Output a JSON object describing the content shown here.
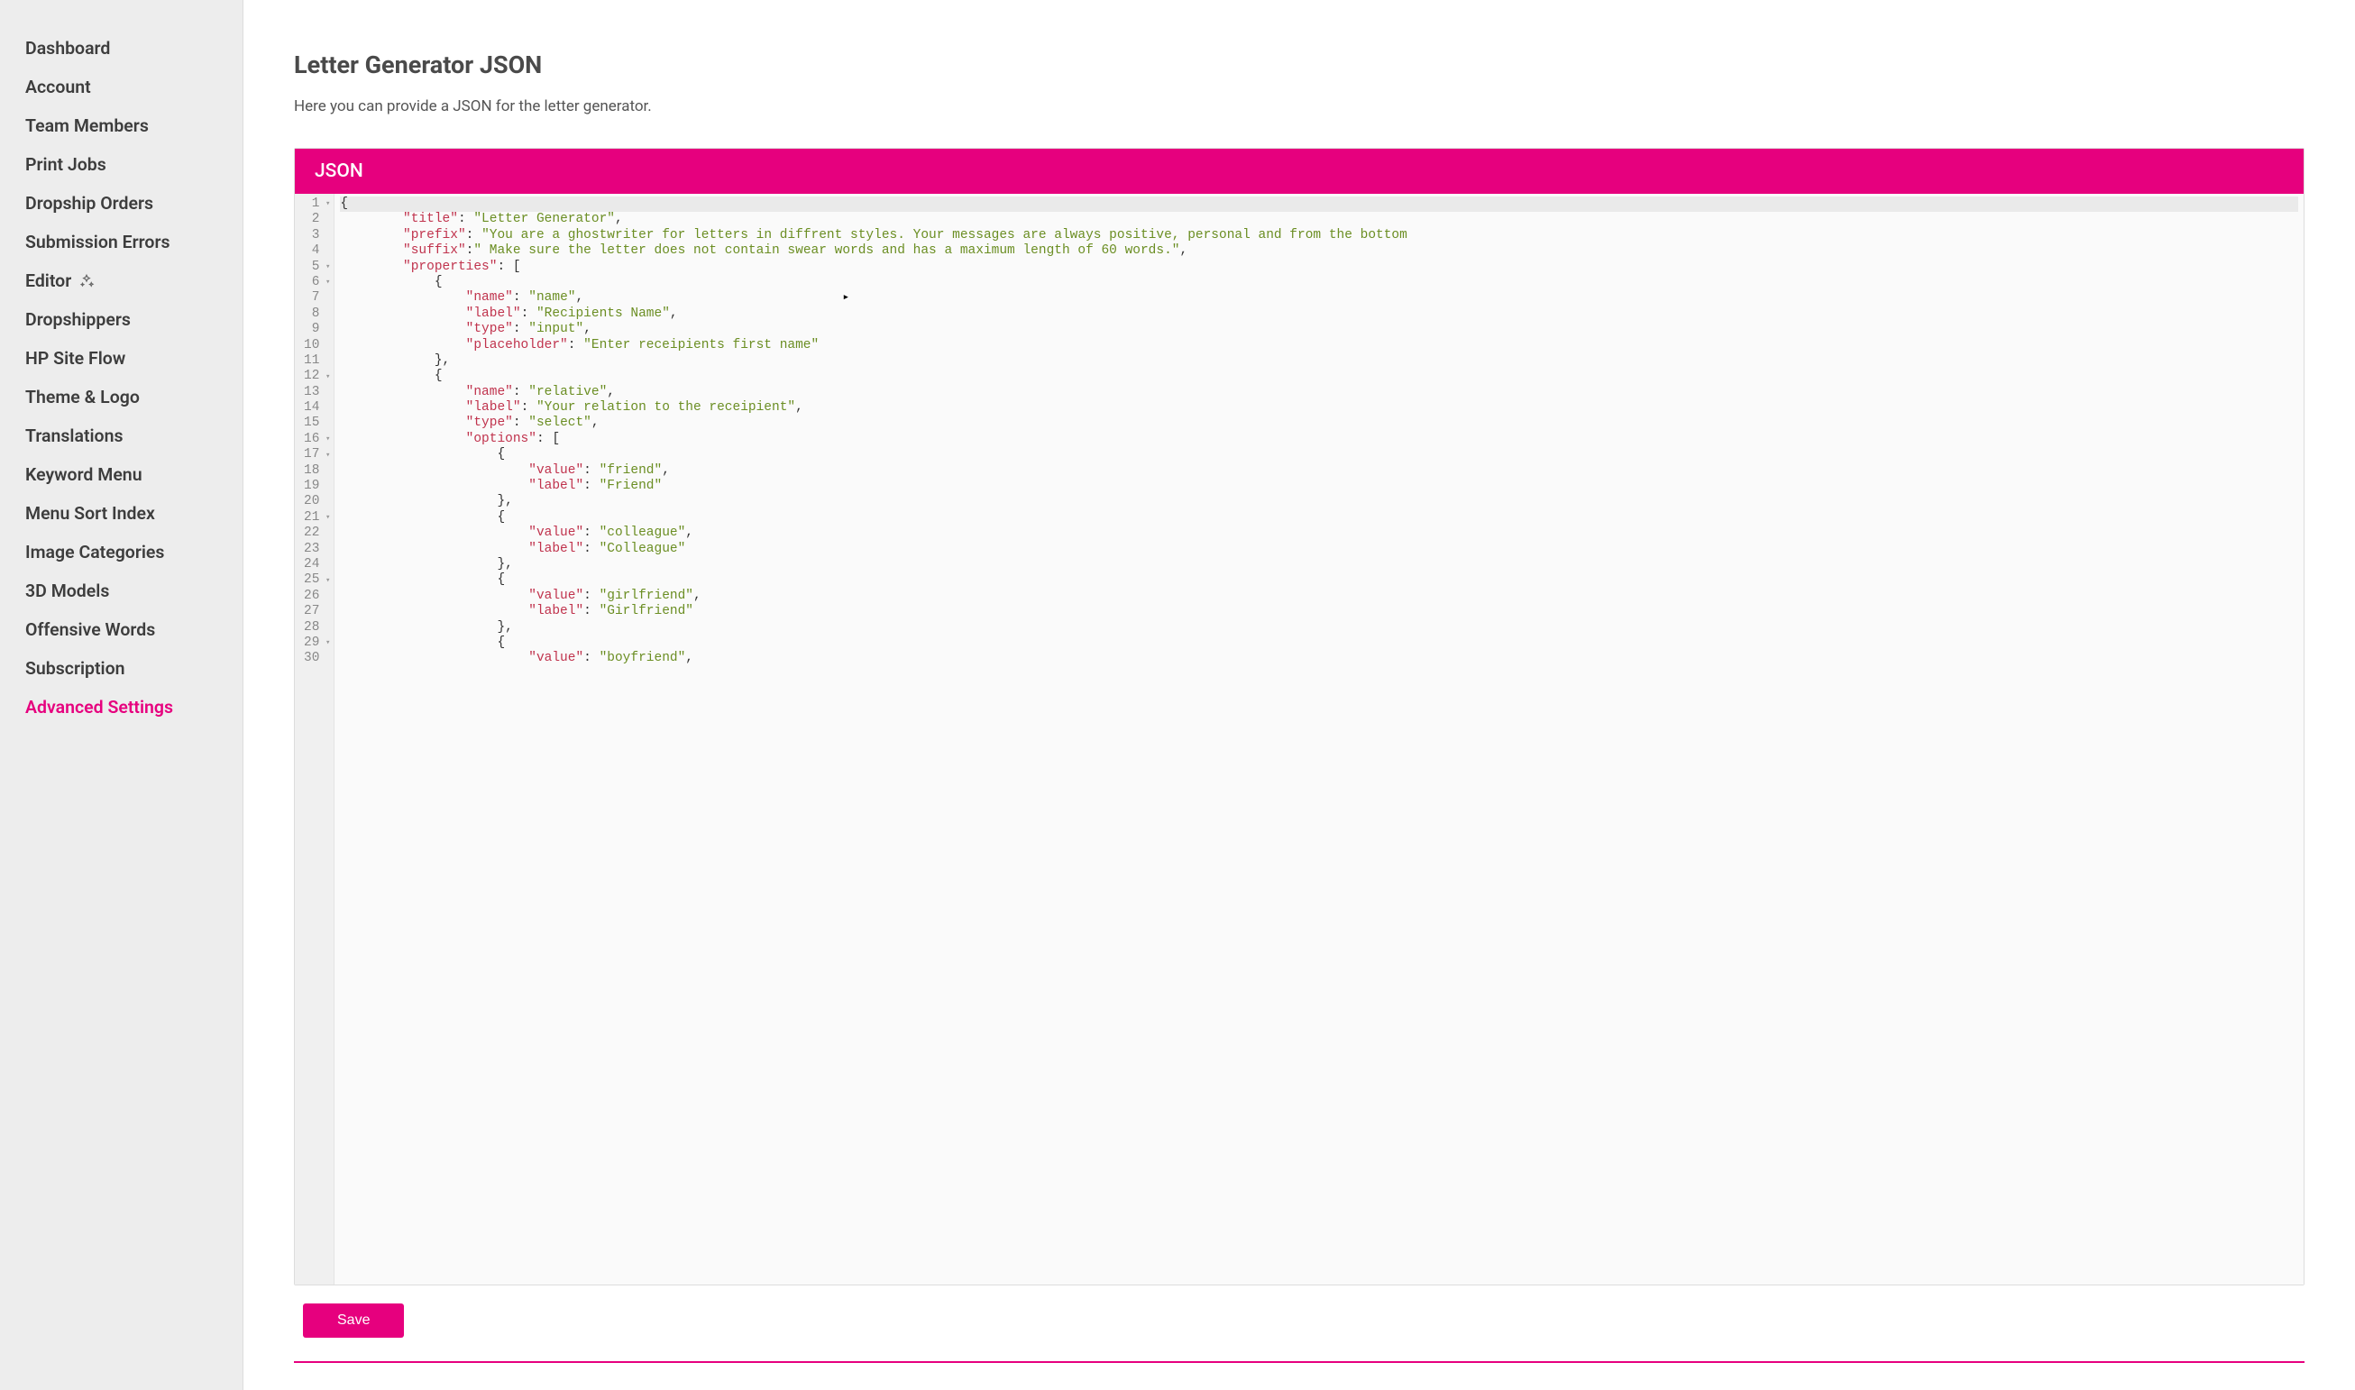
{
  "sidebar": {
    "items": [
      {
        "label": "Dashboard",
        "icon": null,
        "active": false
      },
      {
        "label": "Account",
        "icon": null,
        "active": false
      },
      {
        "label": "Team Members",
        "icon": null,
        "active": false
      },
      {
        "label": "Print Jobs",
        "icon": null,
        "active": false
      },
      {
        "label": "Dropship Orders",
        "icon": null,
        "active": false
      },
      {
        "label": "Submission Errors",
        "icon": null,
        "active": false
      },
      {
        "label": "Editor",
        "icon": "sparkle-icon",
        "active": false
      },
      {
        "label": "Dropshippers",
        "icon": null,
        "active": false
      },
      {
        "label": "HP Site Flow",
        "icon": null,
        "active": false
      },
      {
        "label": "Theme & Logo",
        "icon": null,
        "active": false
      },
      {
        "label": "Translations",
        "icon": null,
        "active": false
      },
      {
        "label": "Keyword Menu",
        "icon": null,
        "active": false
      },
      {
        "label": "Menu Sort Index",
        "icon": null,
        "active": false
      },
      {
        "label": "Image Categories",
        "icon": null,
        "active": false
      },
      {
        "label": "3D Models",
        "icon": null,
        "active": false
      },
      {
        "label": "Offensive Words",
        "icon": null,
        "active": false
      },
      {
        "label": "Subscription",
        "icon": null,
        "active": false
      },
      {
        "label": "Advanced Settings",
        "icon": null,
        "active": true
      }
    ]
  },
  "page": {
    "title": "Letter Generator JSON",
    "description": "Here you can provide a JSON for the letter generator."
  },
  "panel": {
    "title": "JSON"
  },
  "editor": {
    "lines": [
      {
        "n": 1,
        "fold": true,
        "hl": true,
        "indent": 0,
        "tokens": [
          {
            "t": "punc",
            "v": "{"
          }
        ]
      },
      {
        "n": 2,
        "fold": false,
        "hl": false,
        "indent": 2,
        "tokens": [
          {
            "t": "key",
            "v": "\"title\""
          },
          {
            "t": "colon",
            "v": ": "
          },
          {
            "t": "str",
            "v": "\"Letter Generator\""
          },
          {
            "t": "punc",
            "v": ","
          }
        ]
      },
      {
        "n": 3,
        "fold": false,
        "hl": false,
        "indent": 2,
        "tokens": [
          {
            "t": "key",
            "v": "\"prefix\""
          },
          {
            "t": "colon",
            "v": ": "
          },
          {
            "t": "str",
            "v": "\"You are a ghostwriter for letters in diffrent styles. Your messages are always positive, personal and from the bottom"
          }
        ]
      },
      {
        "n": 4,
        "fold": false,
        "hl": false,
        "indent": 2,
        "tokens": [
          {
            "t": "key",
            "v": "\"suffix\""
          },
          {
            "t": "colon",
            "v": ":"
          },
          {
            "t": "str",
            "v": "\" Make sure the letter does not contain swear words and has a maximum length of 60 words.\""
          },
          {
            "t": "punc",
            "v": ","
          }
        ]
      },
      {
        "n": 5,
        "fold": true,
        "hl": false,
        "indent": 2,
        "tokens": [
          {
            "t": "key",
            "v": "\"properties\""
          },
          {
            "t": "colon",
            "v": ": "
          },
          {
            "t": "punc",
            "v": "["
          }
        ]
      },
      {
        "n": 6,
        "fold": true,
        "hl": false,
        "indent": 3,
        "tokens": [
          {
            "t": "punc",
            "v": "{"
          }
        ]
      },
      {
        "n": 7,
        "fold": false,
        "hl": false,
        "indent": 4,
        "tokens": [
          {
            "t": "key",
            "v": "\"name\""
          },
          {
            "t": "colon",
            "v": ": "
          },
          {
            "t": "str",
            "v": "\"name\""
          },
          {
            "t": "punc",
            "v": ","
          }
        ]
      },
      {
        "n": 8,
        "fold": false,
        "hl": false,
        "indent": 4,
        "tokens": [
          {
            "t": "key",
            "v": "\"label\""
          },
          {
            "t": "colon",
            "v": ": "
          },
          {
            "t": "str",
            "v": "\"Recipients Name\""
          },
          {
            "t": "punc",
            "v": ","
          }
        ]
      },
      {
        "n": 9,
        "fold": false,
        "hl": false,
        "indent": 4,
        "tokens": [
          {
            "t": "key",
            "v": "\"type\""
          },
          {
            "t": "colon",
            "v": ": "
          },
          {
            "t": "str",
            "v": "\"input\""
          },
          {
            "t": "punc",
            "v": ","
          }
        ]
      },
      {
        "n": 10,
        "fold": false,
        "hl": false,
        "indent": 4,
        "tokens": [
          {
            "t": "key",
            "v": "\"placeholder\""
          },
          {
            "t": "colon",
            "v": ": "
          },
          {
            "t": "str",
            "v": "\"Enter receipients first name\""
          }
        ]
      },
      {
        "n": 11,
        "fold": false,
        "hl": false,
        "indent": 3,
        "tokens": [
          {
            "t": "punc",
            "v": "},"
          }
        ]
      },
      {
        "n": 12,
        "fold": true,
        "hl": false,
        "indent": 3,
        "tokens": [
          {
            "t": "punc",
            "v": "{"
          }
        ]
      },
      {
        "n": 13,
        "fold": false,
        "hl": false,
        "indent": 4,
        "tokens": [
          {
            "t": "key",
            "v": "\"name\""
          },
          {
            "t": "colon",
            "v": ": "
          },
          {
            "t": "str",
            "v": "\"relative\""
          },
          {
            "t": "punc",
            "v": ","
          }
        ]
      },
      {
        "n": 14,
        "fold": false,
        "hl": false,
        "indent": 4,
        "tokens": [
          {
            "t": "key",
            "v": "\"label\""
          },
          {
            "t": "colon",
            "v": ": "
          },
          {
            "t": "str",
            "v": "\"Your relation to the receipient\""
          },
          {
            "t": "punc",
            "v": ","
          }
        ]
      },
      {
        "n": 15,
        "fold": false,
        "hl": false,
        "indent": 4,
        "tokens": [
          {
            "t": "key",
            "v": "\"type\""
          },
          {
            "t": "colon",
            "v": ": "
          },
          {
            "t": "str",
            "v": "\"select\""
          },
          {
            "t": "punc",
            "v": ","
          }
        ]
      },
      {
        "n": 16,
        "fold": true,
        "hl": false,
        "indent": 4,
        "tokens": [
          {
            "t": "key",
            "v": "\"options\""
          },
          {
            "t": "colon",
            "v": ": "
          },
          {
            "t": "punc",
            "v": "["
          }
        ]
      },
      {
        "n": 17,
        "fold": true,
        "hl": false,
        "indent": 5,
        "tokens": [
          {
            "t": "punc",
            "v": "{"
          }
        ]
      },
      {
        "n": 18,
        "fold": false,
        "hl": false,
        "indent": 6,
        "tokens": [
          {
            "t": "key",
            "v": "\"value\""
          },
          {
            "t": "colon",
            "v": ": "
          },
          {
            "t": "str",
            "v": "\"friend\""
          },
          {
            "t": "punc",
            "v": ","
          }
        ]
      },
      {
        "n": 19,
        "fold": false,
        "hl": false,
        "indent": 6,
        "tokens": [
          {
            "t": "key",
            "v": "\"label\""
          },
          {
            "t": "colon",
            "v": ": "
          },
          {
            "t": "str",
            "v": "\"Friend\""
          }
        ]
      },
      {
        "n": 20,
        "fold": false,
        "hl": false,
        "indent": 5,
        "tokens": [
          {
            "t": "punc",
            "v": "},"
          }
        ]
      },
      {
        "n": 21,
        "fold": true,
        "hl": false,
        "indent": 5,
        "tokens": [
          {
            "t": "punc",
            "v": "{"
          }
        ]
      },
      {
        "n": 22,
        "fold": false,
        "hl": false,
        "indent": 6,
        "tokens": [
          {
            "t": "key",
            "v": "\"value\""
          },
          {
            "t": "colon",
            "v": ": "
          },
          {
            "t": "str",
            "v": "\"colleague\""
          },
          {
            "t": "punc",
            "v": ","
          }
        ]
      },
      {
        "n": 23,
        "fold": false,
        "hl": false,
        "indent": 6,
        "tokens": [
          {
            "t": "key",
            "v": "\"label\""
          },
          {
            "t": "colon",
            "v": ": "
          },
          {
            "t": "str",
            "v": "\"Colleague\""
          }
        ]
      },
      {
        "n": 24,
        "fold": false,
        "hl": false,
        "indent": 5,
        "tokens": [
          {
            "t": "punc",
            "v": "},"
          }
        ]
      },
      {
        "n": 25,
        "fold": true,
        "hl": false,
        "indent": 5,
        "tokens": [
          {
            "t": "punc",
            "v": "{"
          }
        ]
      },
      {
        "n": 26,
        "fold": false,
        "hl": false,
        "indent": 6,
        "tokens": [
          {
            "t": "key",
            "v": "\"value\""
          },
          {
            "t": "colon",
            "v": ": "
          },
          {
            "t": "str",
            "v": "\"girlfriend\""
          },
          {
            "t": "punc",
            "v": ","
          }
        ]
      },
      {
        "n": 27,
        "fold": false,
        "hl": false,
        "indent": 6,
        "tokens": [
          {
            "t": "key",
            "v": "\"label\""
          },
          {
            "t": "colon",
            "v": ": "
          },
          {
            "t": "str",
            "v": "\"Girlfriend\""
          }
        ]
      },
      {
        "n": 28,
        "fold": false,
        "hl": false,
        "indent": 5,
        "tokens": [
          {
            "t": "punc",
            "v": "},"
          }
        ]
      },
      {
        "n": 29,
        "fold": true,
        "hl": false,
        "indent": 5,
        "tokens": [
          {
            "t": "punc",
            "v": "{"
          }
        ]
      },
      {
        "n": 30,
        "fold": false,
        "hl": false,
        "indent": 6,
        "tokens": [
          {
            "t": "key",
            "v": "\"value\""
          },
          {
            "t": "colon",
            "v": ": "
          },
          {
            "t": "str",
            "v": "\"boyfriend\""
          },
          {
            "t": "punc",
            "v": ","
          }
        ]
      }
    ],
    "cursor_line": 7
  },
  "footer": {
    "save_label": "Save"
  }
}
